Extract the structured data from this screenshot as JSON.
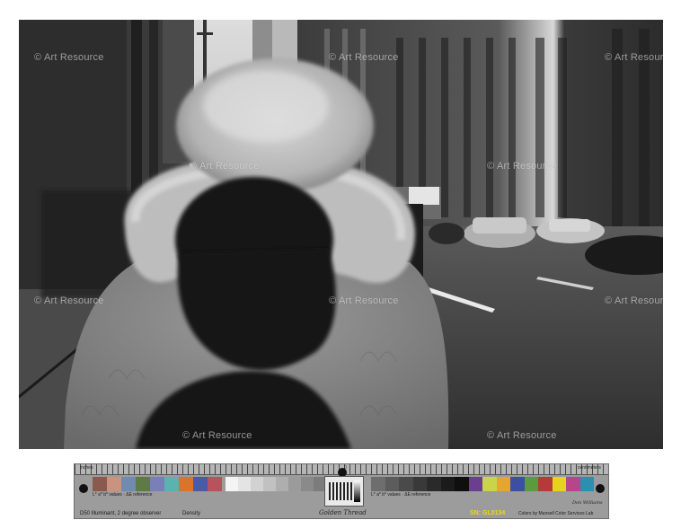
{
  "photo": {
    "subject": "woman-fur-hood-shadow",
    "watermark": "© Art Resource"
  },
  "target": {
    "top_patches": [
      "#8a5a4f",
      "#c9937f",
      "#6f8bb0",
      "#5e7a45",
      "#7b7fb8",
      "#5bb3b0",
      "#d9742a",
      "#4a5aa6",
      "#b8525c"
    ],
    "top_patches_b": [
      "#5e3a6f",
      "#9fbf3a",
      "#e0a52a"
    ],
    "gray_left": [
      "#f4f4f4",
      "#e4e4e4",
      "#d2d2d2",
      "#c1c1c1",
      "#aeaeae",
      "#9b9b9b"
    ],
    "gray_right": [
      "#6e6e6e",
      "#5c5c5c",
      "#4a4a4a",
      "#393939",
      "#2a2a2a",
      "#1b1b1b",
      "#0f0f0f"
    ],
    "color_right": [
      "#6b3f8f",
      "#c8d54a",
      "#e5a531",
      "#3c4fa0",
      "#5b9b3e",
      "#b53a3a",
      "#e8d21e",
      "#b6458c",
      "#2c8fb0"
    ],
    "illuminant": "D50 Illuminant, 2 degree observer",
    "density_label": "Density",
    "script": "Golden Thread",
    "serial": "SN: GL0134",
    "colors_by": "Colors by Munsell Color Services Lab",
    "signature": "Don Williams"
  }
}
